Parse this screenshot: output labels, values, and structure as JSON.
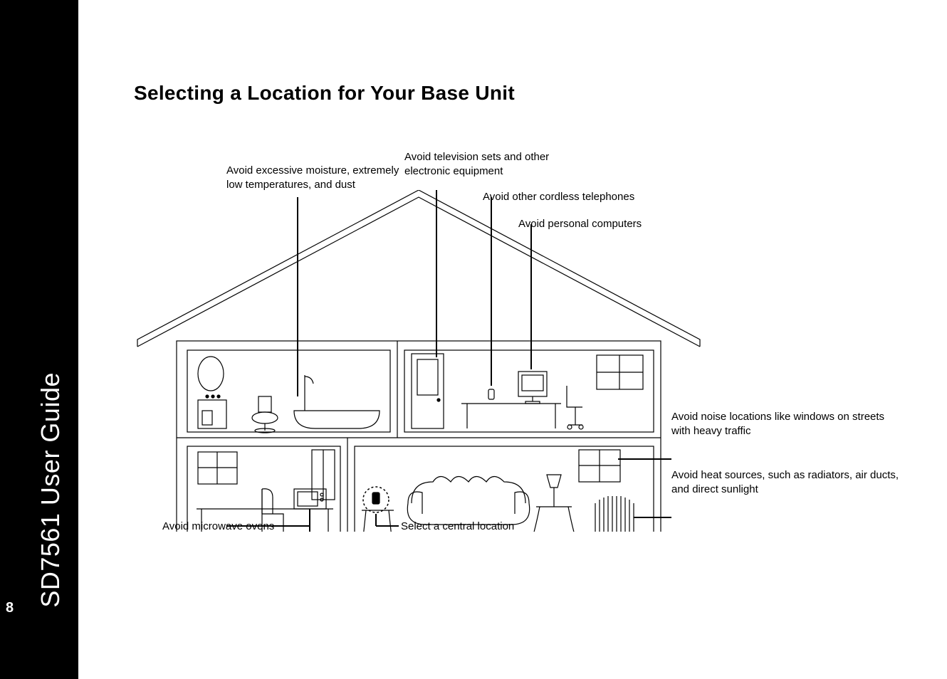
{
  "sidebar": {
    "doc_title": "SD7561 User Guide",
    "page_number": "8"
  },
  "page": {
    "title": "Selecting a Location for Your Base Unit"
  },
  "callouts": {
    "moisture": "Avoid excessive moisture, extremely low temperatures, and dust",
    "tv": "Avoid television sets and other electronic equipment",
    "cordless": "Avoid other cordless telephones",
    "pc": "Avoid personal computers",
    "noise": "Avoid noise locations like windows on streets with heavy traffic",
    "heat": "Avoid heat sources, such as radiators, air ducts, and direct sunlight",
    "microwave": "Avoid microwave ovens",
    "central": "Select a central location"
  }
}
